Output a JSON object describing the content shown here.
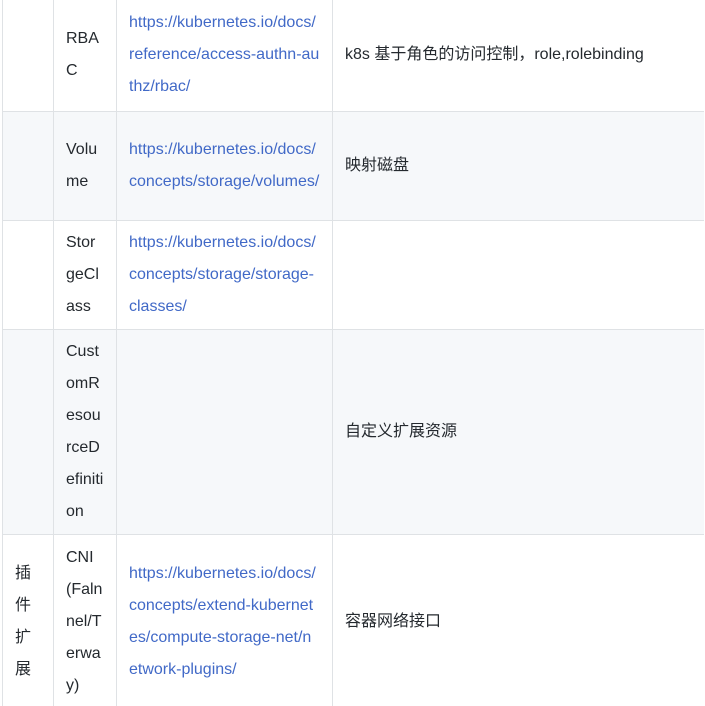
{
  "table": {
    "rows": [
      {
        "category": "",
        "name": "RBAC",
        "link": "https://kubernetes.io/docs/reference/access-authn-authz/rbac/",
        "desc": "k8s 基于角色的访问控制，role,rolebinding"
      },
      {
        "category": "",
        "name": "Volume",
        "link": "https://kubernetes.io/docs/concepts/storage/volumes/",
        "desc": "映射磁盘"
      },
      {
        "category": "",
        "name": "StorgeClass",
        "link": "https://kubernetes.io/docs/concepts/storage/storage-classes/",
        "desc": ""
      },
      {
        "category": "",
        "name": "CustomResourceDefinition",
        "link": "",
        "desc": "自定义扩展资源"
      },
      {
        "category": "插件扩展",
        "name": "CNI(Falnnel/Terway)",
        "link": "https://kubernetes.io/docs/concepts/extend-kubernetes/compute-storage-net/network-plugins/",
        "desc": "容器网络接口"
      }
    ]
  },
  "colors": {
    "link": "#4169c7",
    "border": "#dfe2e5",
    "alt_row_bg": "#f6f8fa",
    "text": "#24292e"
  }
}
